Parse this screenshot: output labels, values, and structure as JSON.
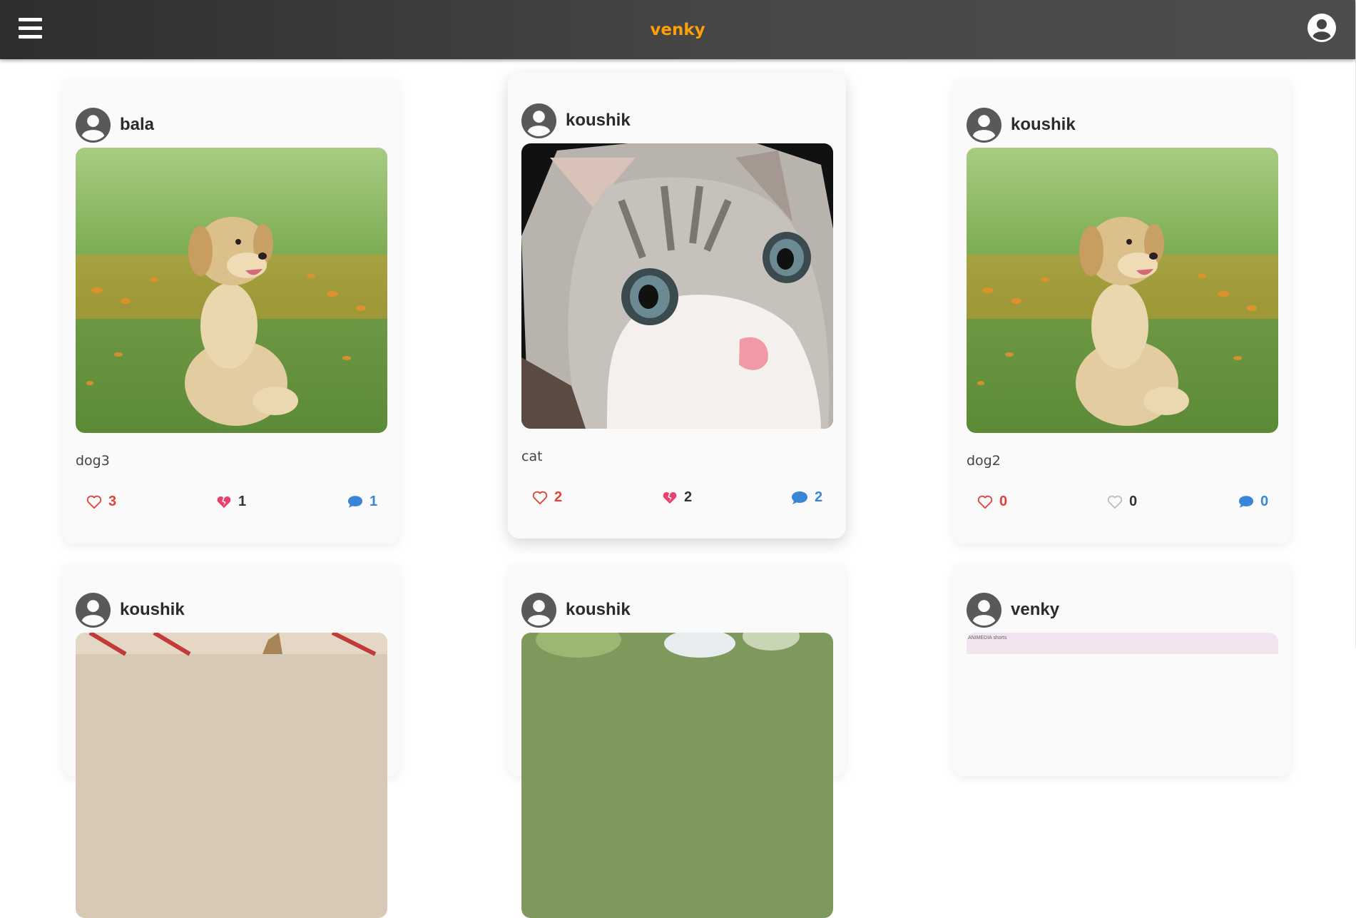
{
  "header": {
    "title": "venky",
    "title_color": "#ff9f0a",
    "menu_icon": "hamburger-menu-icon",
    "profile_icon": "user-circle-icon"
  },
  "posts": [
    {
      "username": "bala",
      "image": "golden-retriever-puppy-photo",
      "caption": "dog3",
      "likes": "3",
      "dislikes": "1",
      "comments": "1",
      "liked": false,
      "disliked": true
    },
    {
      "username": "koushik",
      "image": "kitten-closeup-photo",
      "caption": "cat",
      "likes": "2",
      "dislikes": "2",
      "comments": "2",
      "liked": false,
      "disliked": true
    },
    {
      "username": "koushik",
      "image": "golden-retriever-puppy-photo",
      "caption": "dog2",
      "likes": "0",
      "dislikes": "0",
      "comments": "0",
      "liked": false,
      "disliked": false
    },
    {
      "username": "koushik",
      "image": "partial-photo"
    },
    {
      "username": "koushik",
      "image": "partial-photo"
    },
    {
      "username": "venky",
      "image": "screenshot-thumbnail",
      "thumb_text": "ANIMEDIA shorts"
    }
  ],
  "colors": {
    "like": "#e0413a",
    "dislike_active": "#e8416d",
    "comment": "#3a86d6",
    "header_bg": "#3d3d3d"
  }
}
